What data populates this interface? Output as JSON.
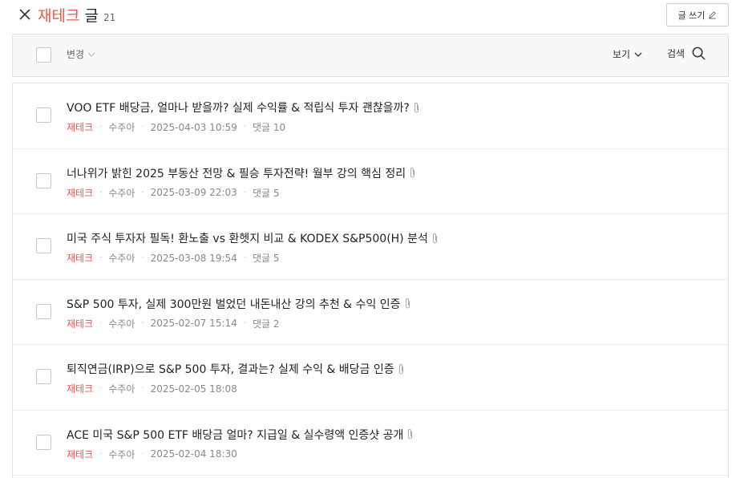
{
  "header": {
    "category": "재테크",
    "title_word": "글",
    "count": "21",
    "write_label": "글 쓰기"
  },
  "toolbar": {
    "change_label": "변경",
    "view_label": "보기",
    "search_label": "검색"
  },
  "posts": [
    {
      "title": "VOO ETF 배당금, 얼마나 받을까? 실제 수익률 & 적립식 투자 괜찮을까?",
      "category": "재테크",
      "author": "수주아",
      "date": "2025-04-03 10:59",
      "comments": "댓글 10"
    },
    {
      "title": "너나위가 밝힌 2025 부동산 전망 & 필승 투자전략! 월부 강의 핵심 정리",
      "category": "재테크",
      "author": "수주아",
      "date": "2025-03-09 22:03",
      "comments": "댓글 5"
    },
    {
      "title": "미국 주식 투자자 필독! 환노출 vs 환헷지 비교 & KODEX S&P500(H) 분석",
      "category": "재테크",
      "author": "수주아",
      "date": "2025-03-08 19:54",
      "comments": "댓글 5"
    },
    {
      "title": "S&P 500 투자, 실제 300만원 벌었던 내돈내산 강의 추천 & 수익 인증",
      "category": "재테크",
      "author": "수주아",
      "date": "2025-02-07 15:14",
      "comments": "댓글 2"
    },
    {
      "title": "퇴직연금(IRP)으로 S&P 500 투자, 결과는? 실제 수익 & 배당금 인증",
      "category": "재테크",
      "author": "수주아",
      "date": "2025-02-05 18:08",
      "comments": ""
    },
    {
      "title": "ACE 미국 S&P 500 ETF 배당금 얼마? 지급일 & 실수령액 인증샷 공개",
      "category": "재테크",
      "author": "수주아",
      "date": "2025-02-04 18:30",
      "comments": ""
    }
  ],
  "colors": {
    "accent": "#f0554b",
    "meta": "#888888",
    "toolbar_bg": "#f8f8f8"
  }
}
